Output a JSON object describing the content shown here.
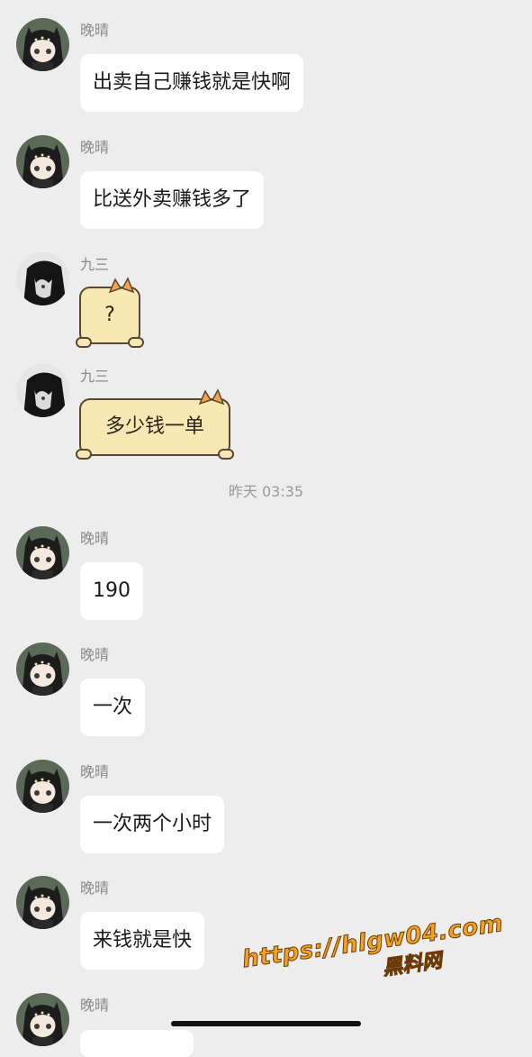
{
  "timestamp": "昨天 03:35",
  "messages": [
    {
      "sender": "晚晴",
      "text": "出卖自己赚钱就是快啊",
      "avatar": "anime-girl-avatar"
    },
    {
      "sender": "晚晴",
      "text": "比送外卖赚钱多了",
      "avatar": "anime-girl-avatar"
    },
    {
      "sender": "九三",
      "text": "?",
      "avatar": "dark-hair-avatar",
      "style": "cat-bubble"
    },
    {
      "sender": "九三",
      "text": "多少钱一单",
      "avatar": "dark-hair-avatar",
      "style": "cat-bubble"
    },
    {
      "sender": "晚晴",
      "text": "190",
      "avatar": "anime-girl-avatar"
    },
    {
      "sender": "晚晴",
      "text": "一次",
      "avatar": "anime-girl-avatar"
    },
    {
      "sender": "晚晴",
      "text": "一次两个小时",
      "avatar": "anime-girl-avatar"
    },
    {
      "sender": "晚晴",
      "text": "来钱就是快",
      "avatar": "anime-girl-avatar"
    },
    {
      "sender": "晚晴",
      "text": "",
      "avatar": "anime-girl-avatar"
    }
  ],
  "watermark": {
    "url": "https://hlgw04.com",
    "name": "黑料网"
  },
  "colors": {
    "background": "#ededed",
    "bubble": "#ffffff",
    "cat_bubble": "#f8e9b4",
    "watermark": "#f3a11e"
  }
}
